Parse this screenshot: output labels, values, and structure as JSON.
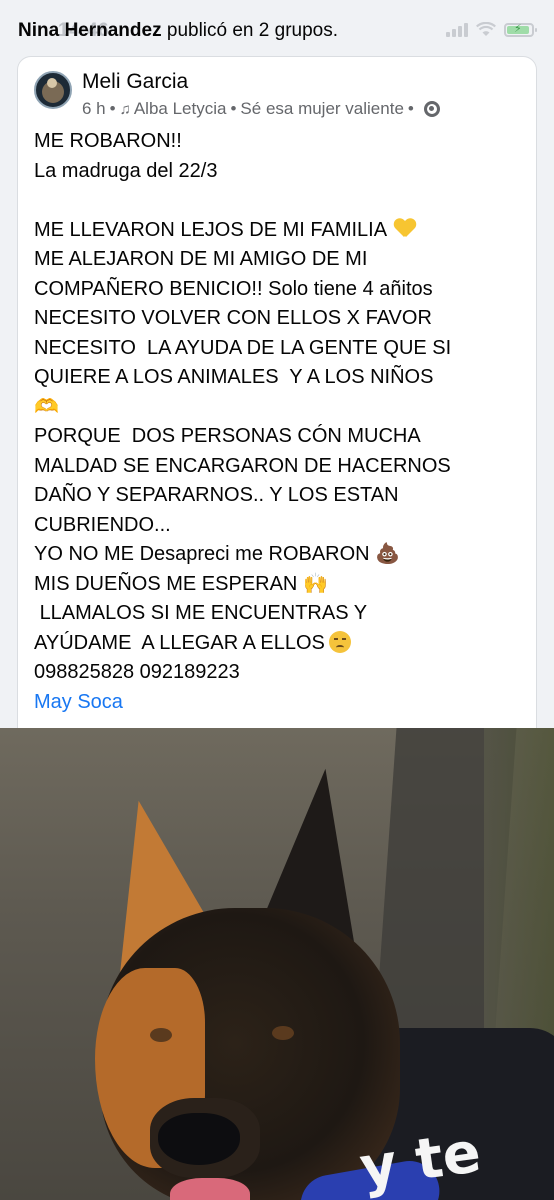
{
  "status_bar": {
    "time": "14:46",
    "icons": [
      "cellular-signal-icon",
      "wifi-icon",
      "battery-charging-icon"
    ]
  },
  "group_header": {
    "actor": "Nina Hernandez",
    "action": "publicó en 2 grupos."
  },
  "post": {
    "author": "Meli Garcia",
    "time": "6 h",
    "separator": "•",
    "song": "Alba Letycia",
    "song_title": "Sé esa mujer valiente",
    "lines": [
      "ME ROBARON!!",
      "La madruga del 22/3",
      "",
      "ME LLEVARON LEJOS DE MI FAMILIA",
      "ME ALEJARON DE MI AMIGO DE MI",
      "COMPAÑERO BENICIO!! Solo tiene 4 añitos",
      "NECESITO VOLVER CON ELLOS X FAVOR",
      "NECESITO  LA AYUDA DE LA GENTE QUE SI",
      "QUIERE A LOS ANIMALES  Y A LOS NIÑOS",
      "",
      "PORQUE  DOS PERSONAS CÓN MUCHA",
      "MALDAD SE ENCARGARON DE HACERNOS",
      "DAÑO Y SEPARARNOS.. Y LOS ESTAN",
      "CUBRIENDO...",
      "YO NO ME Desapreci me ROBARON",
      "MIS DUEÑOS ME ESPERAN",
      " LLAMALOS SI ME ENCUENTRAS Y",
      "AYÚDAME  A LLEGAR A ELLOS",
      "098825828 092189223"
    ],
    "mention": "May Soca"
  },
  "photo": {
    "sticker_text": "y te"
  },
  "colors": {
    "link": "#1877f2",
    "meta": "#65676b",
    "background": "#f0f2f5"
  }
}
